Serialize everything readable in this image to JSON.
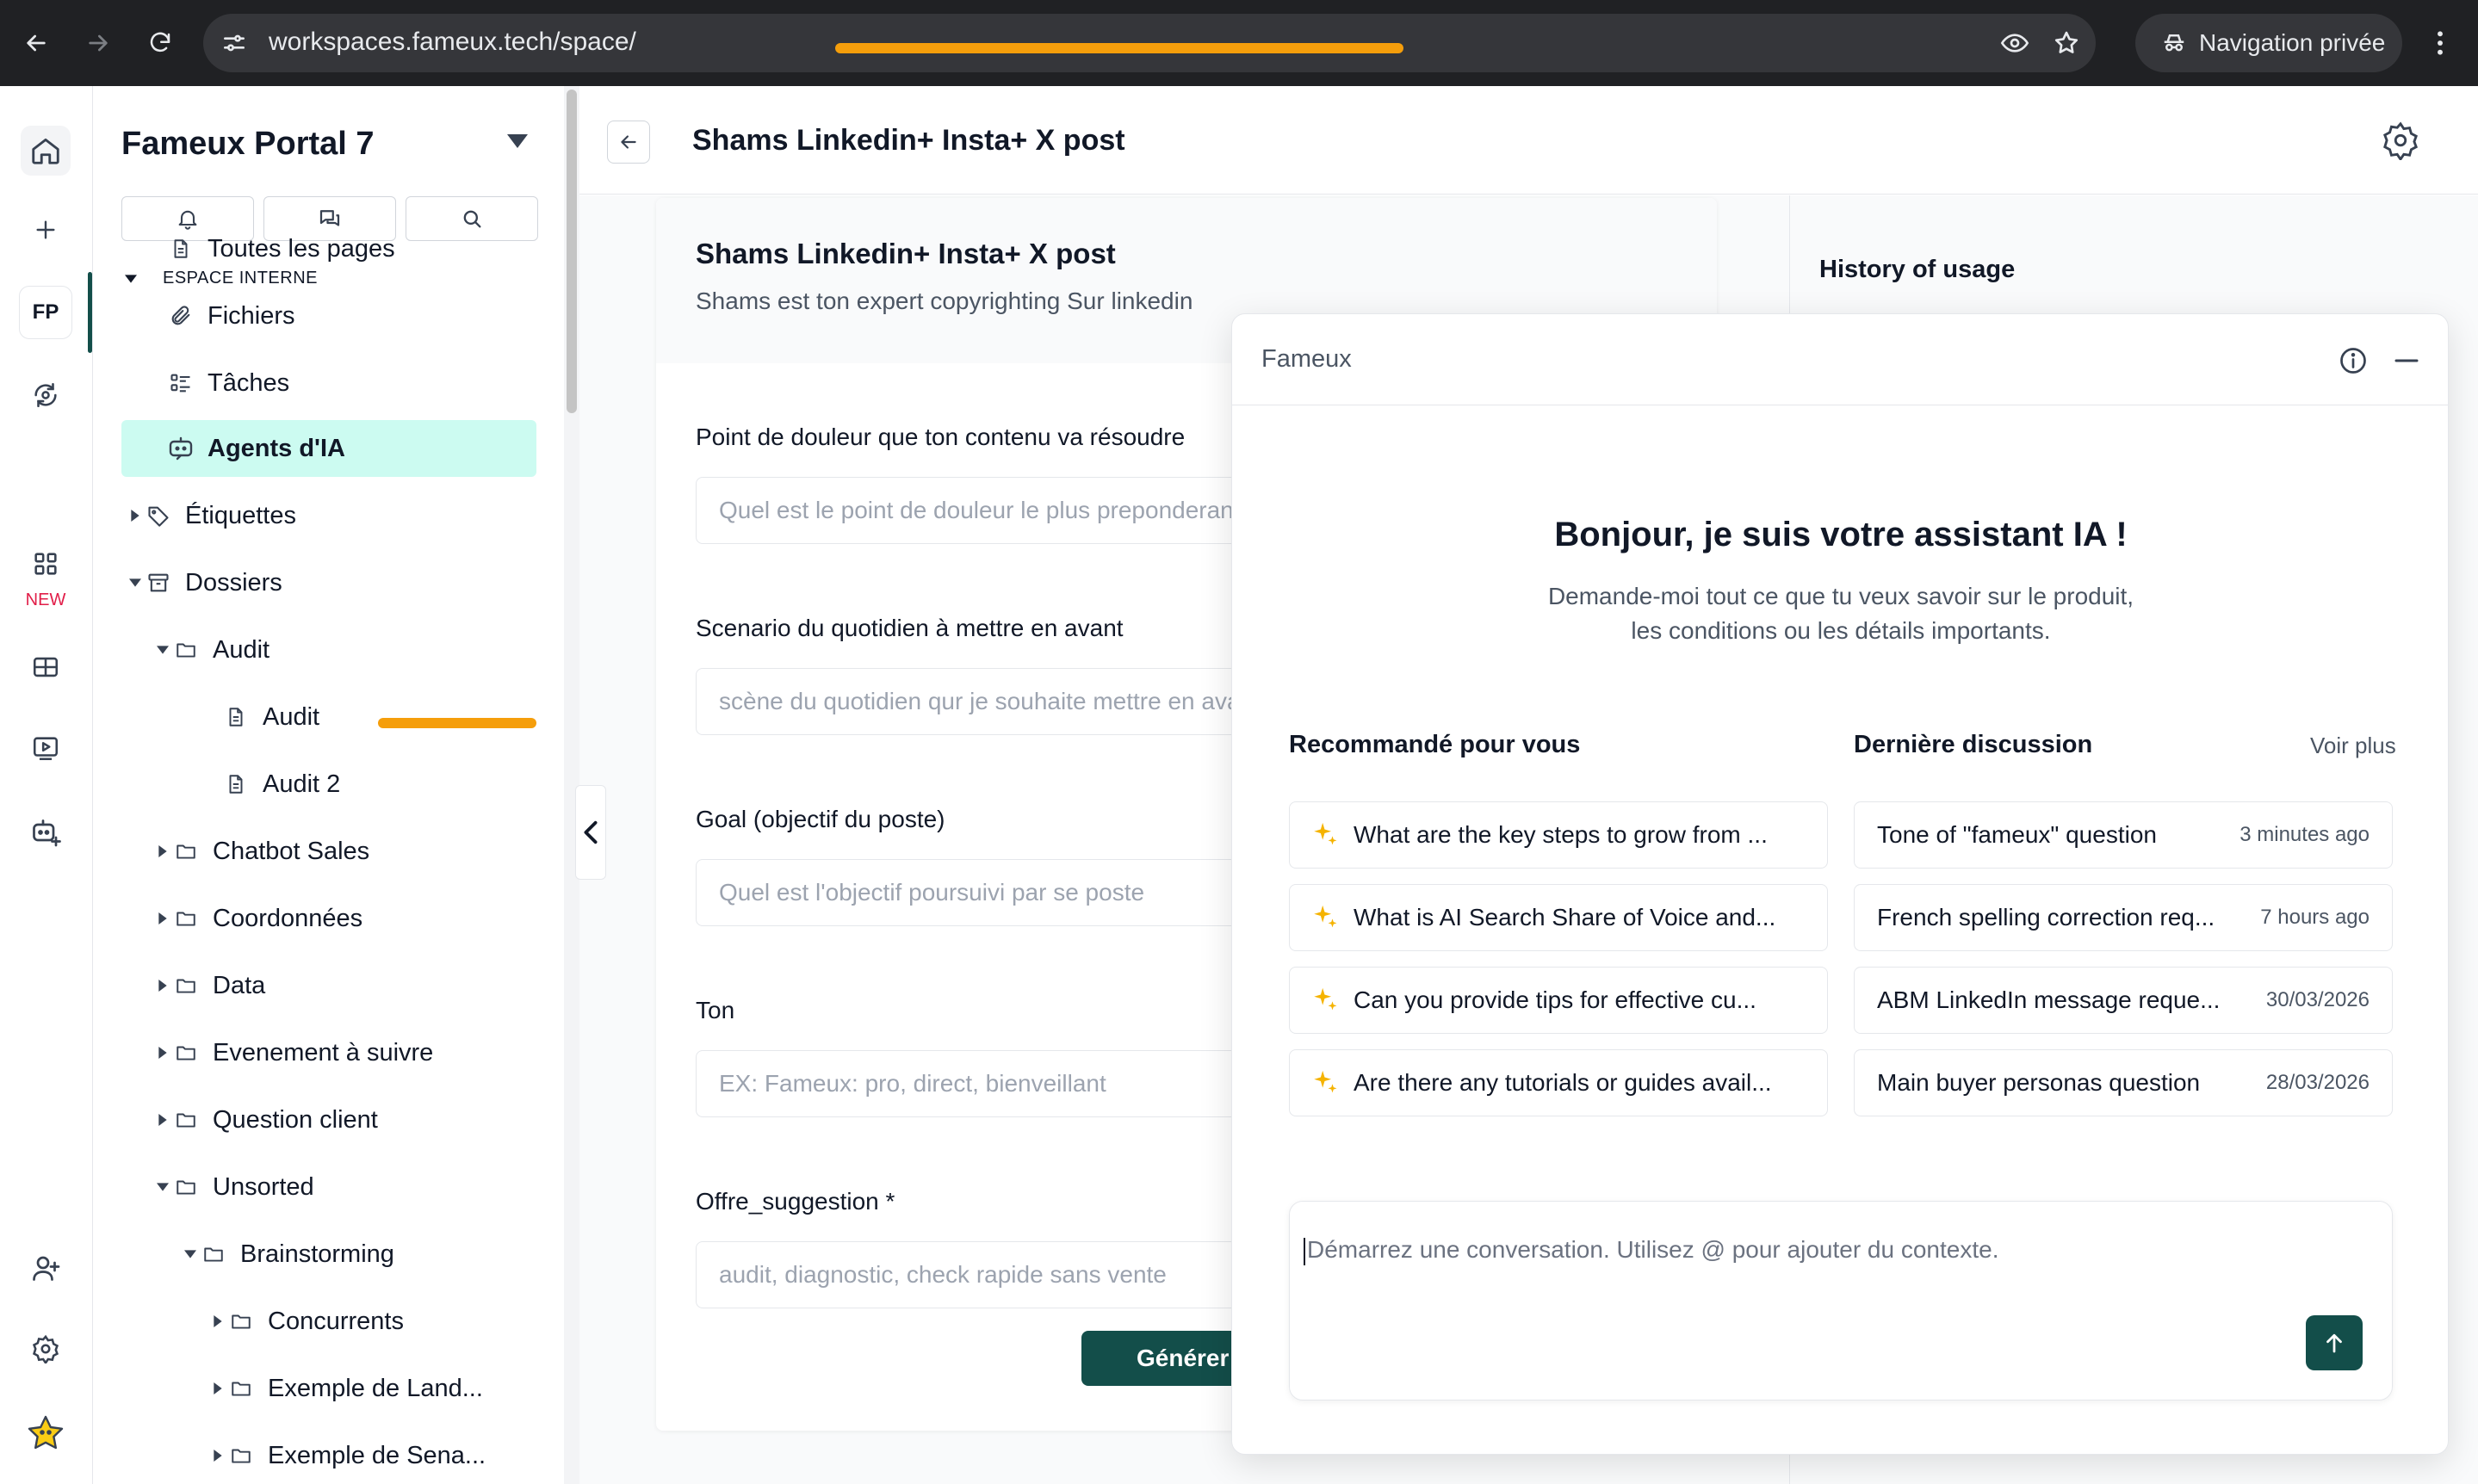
{
  "browser": {
    "url": "workspaces.fameux.tech/space/",
    "private_label": "Navigation privée"
  },
  "rail": {
    "workspace_badge": "FP",
    "new_badge": "NEW"
  },
  "sidebar": {
    "workspace_title": "Fameux Portal 7",
    "section_label": "ESPACE INTERNE",
    "items": [
      {
        "label": "Toutes les pages",
        "icon": "page-icon"
      },
      {
        "label": "Fichiers",
        "icon": "paperclip-icon"
      },
      {
        "label": "Tâches",
        "icon": "tasks-icon"
      },
      {
        "label": "Agents d'IA",
        "icon": "bot-icon",
        "active": true
      },
      {
        "label": "Étiquettes",
        "icon": "tag-icon"
      },
      {
        "label": "Dossiers",
        "icon": "archive-icon"
      },
      {
        "label": "Audit",
        "icon": "folder-icon"
      },
      {
        "label": "Audit",
        "icon": "page-icon"
      },
      {
        "label": "Audit 2",
        "icon": "page-icon"
      },
      {
        "label": "Chatbot Sales",
        "icon": "folder-icon"
      },
      {
        "label": "Coordonnées",
        "icon": "folder-icon"
      },
      {
        "label": "Data",
        "icon": "folder-icon"
      },
      {
        "label": "Evenement à suivre",
        "icon": "folder-icon"
      },
      {
        "label": "Question client",
        "icon": "folder-icon"
      },
      {
        "label": "Unsorted",
        "icon": "folder-icon"
      },
      {
        "label": "Brainstorming",
        "icon": "folder-icon"
      },
      {
        "label": "Concurrents",
        "icon": "folder-icon"
      },
      {
        "label": "Exemple de Land...",
        "icon": "folder-icon"
      },
      {
        "label": "Exemple de Sena...",
        "icon": "folder-icon"
      }
    ]
  },
  "main": {
    "page_title": "Shams Linkedin+ Insta+ X post",
    "agent": {
      "name": "Shams Linkedin+ Insta+ X post",
      "description": "Shams est ton expert copyrighting Sur linkedin"
    },
    "fields": [
      {
        "label": "Point de douleur que ton contenu va résoudre",
        "placeholder": "Quel est le point de douleur le plus preponderant"
      },
      {
        "label": "Scenario du quotidien à mettre en avant",
        "placeholder": "scène du quotidien qur je souhaite mettre en avant"
      },
      {
        "label": "Goal (objectif du poste)",
        "placeholder": "Quel est l'objectif poursuivi  par se poste"
      },
      {
        "label": "Ton",
        "placeholder": "EX: Fameux: pro, direct, bienveillant"
      },
      {
        "label": "Offre_suggestion *",
        "placeholder": "audit, diagnostic, check rapide sans vente"
      }
    ],
    "generate_label": "Générer"
  },
  "history": {
    "title": "History of usage"
  },
  "chat": {
    "brand": "Fameux",
    "greeting_title": "Bonjour, je suis votre assistant IA !",
    "greeting_subtitle": "Demande-moi tout ce que tu veux savoir sur le produit, les conditions ou les détails importants.",
    "recommended_title": "Recommandé pour vous",
    "recent_title": "Dernière discussion",
    "see_more": "Voir plus",
    "suggestions": [
      "What are the key steps to grow from ...",
      "What is AI Search Share of Voice and...",
      "Can you provide tips for effective cu...",
      "Are there any tutorials or guides avail..."
    ],
    "discussions": [
      {
        "title": "Tone of \"fameux\" question",
        "time": "3 minutes ago"
      },
      {
        "title": "French spelling correction req...",
        "time": "7 hours ago"
      },
      {
        "title": "ABM LinkedIn message reque...",
        "time": "30/03/2026"
      },
      {
        "title": "Main buyer personas question",
        "time": "28/03/2026"
      }
    ],
    "composer_placeholder": "Démarrez une conversation. Utilisez @ pour ajouter du contexte."
  },
  "colors": {
    "brand_dark": "#134e4a",
    "active_bg": "#ccfbf1",
    "redaction": "#f59e0b",
    "chrome": "#202124"
  }
}
